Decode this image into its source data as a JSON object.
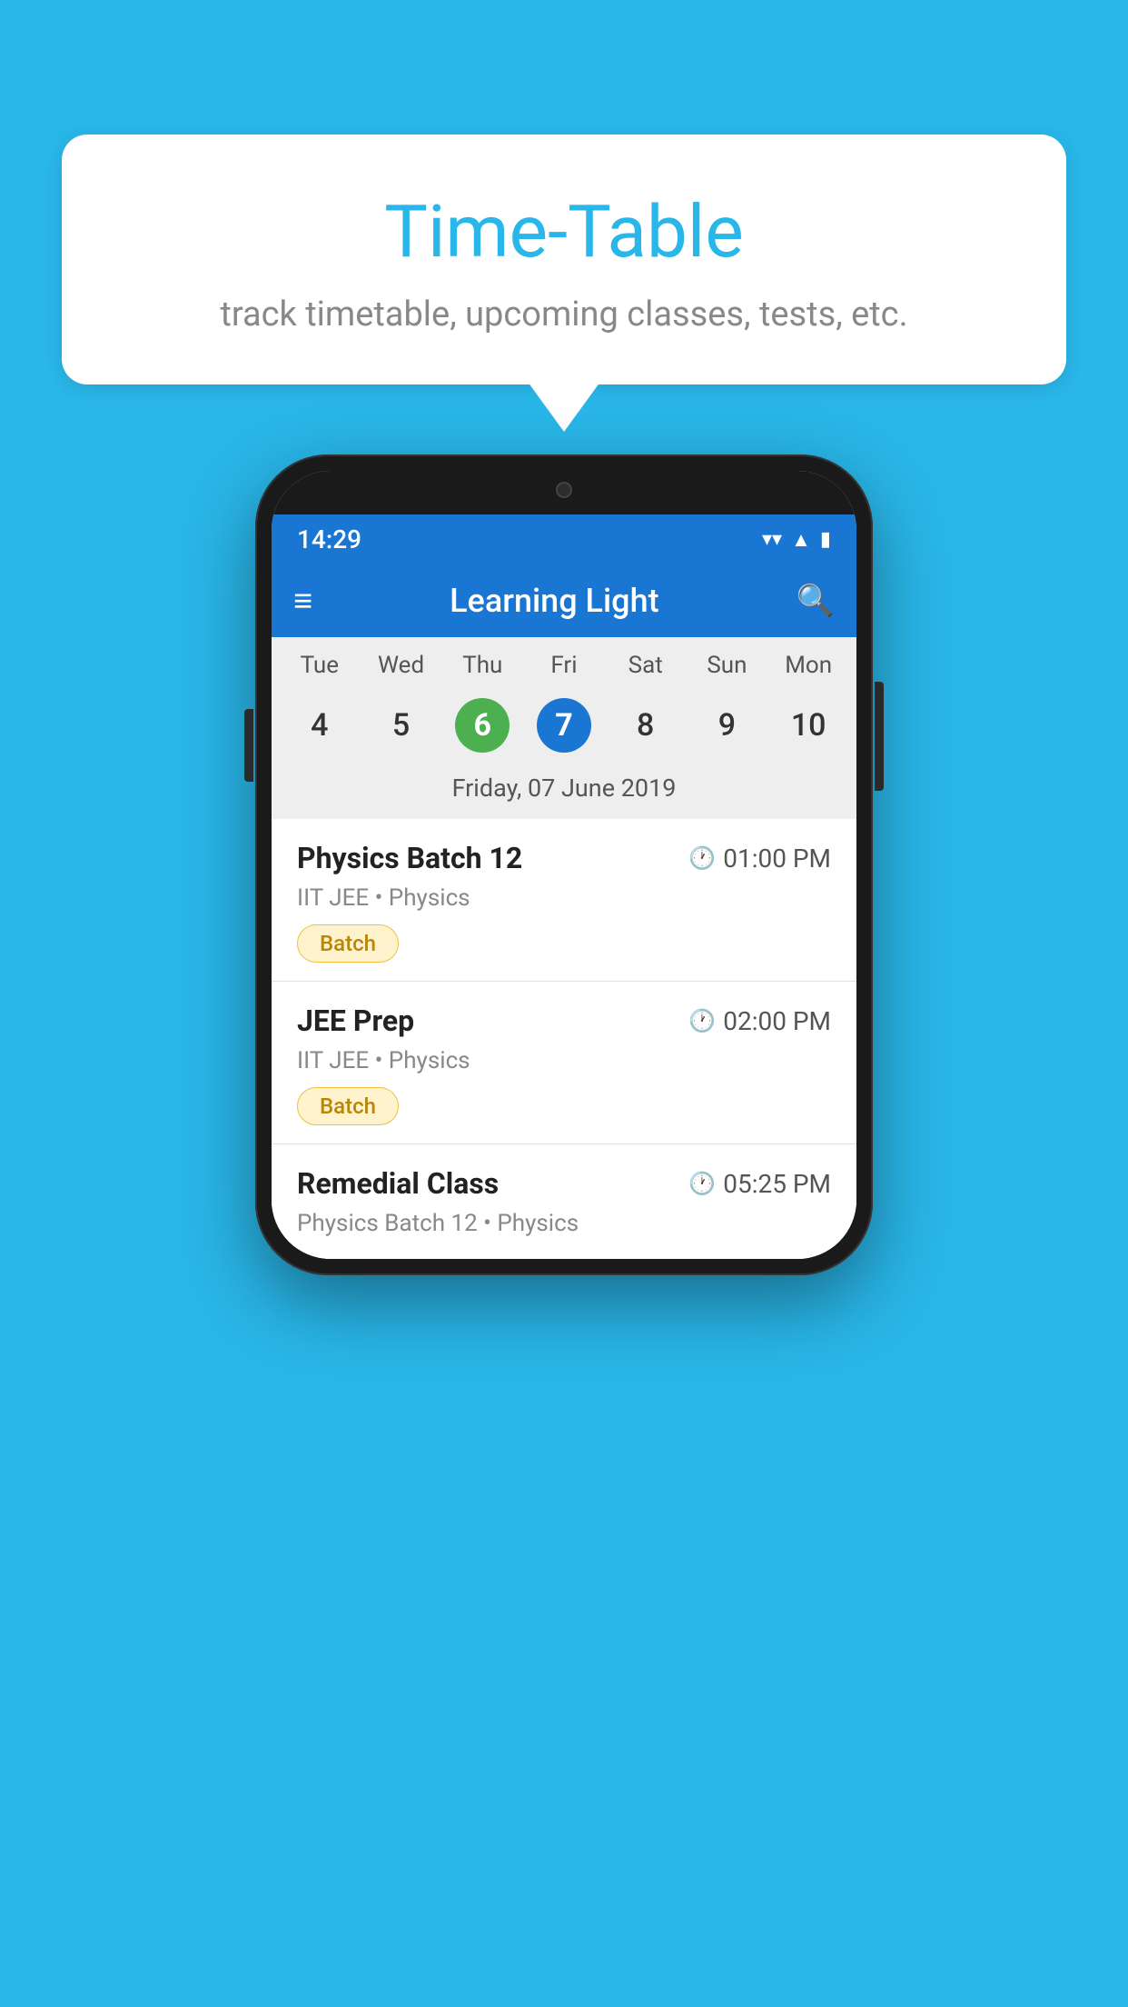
{
  "background_color": "#29B6E8",
  "bubble": {
    "title": "Time-Table",
    "subtitle": "track timetable, upcoming classes, tests, etc."
  },
  "phone": {
    "status_bar": {
      "time": "14:29",
      "icons": [
        "wifi",
        "signal",
        "battery"
      ]
    },
    "app_bar": {
      "title": "Learning Light",
      "hamburger_label": "☰",
      "search_label": "🔍"
    },
    "calendar": {
      "weekdays": [
        "Tue",
        "Wed",
        "Thu",
        "Fri",
        "Sat",
        "Sun",
        "Mon"
      ],
      "dates": [
        4,
        5,
        6,
        7,
        8,
        9,
        10
      ],
      "today_index": 2,
      "selected_index": 3,
      "selected_date_label": "Friday, 07 June 2019"
    },
    "schedule_items": [
      {
        "title": "Physics Batch 12",
        "time": "01:00 PM",
        "subtitle": "IIT JEE • Physics",
        "badge": "Batch"
      },
      {
        "title": "JEE Prep",
        "time": "02:00 PM",
        "subtitle": "IIT JEE • Physics",
        "badge": "Batch"
      },
      {
        "title": "Remedial Class",
        "time": "05:25 PM",
        "subtitle": "Physics Batch 12 • Physics",
        "badge": null
      }
    ]
  }
}
